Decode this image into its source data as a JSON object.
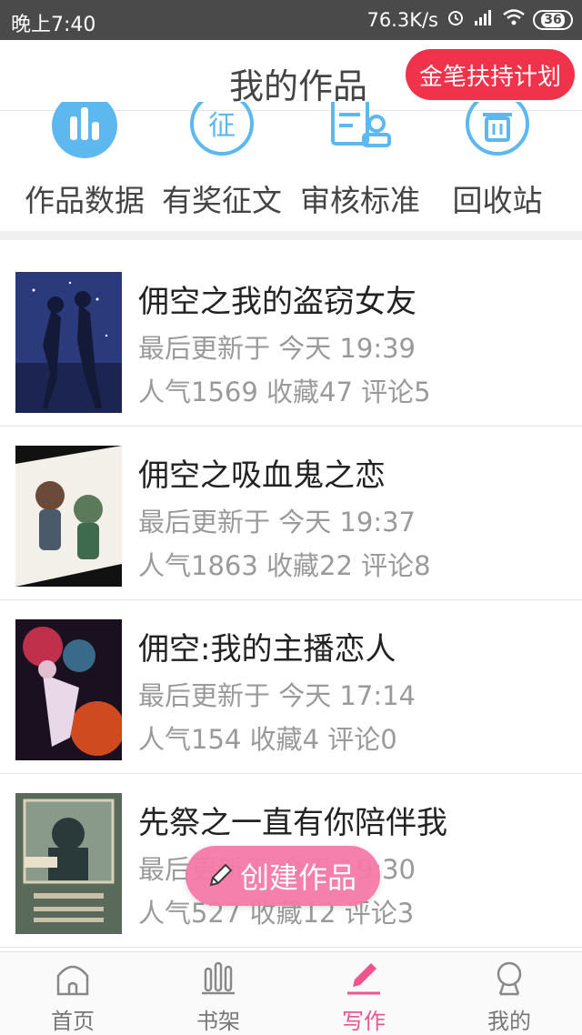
{
  "status_bar": {
    "time": "晚上7:40",
    "speed": "76.3K/s",
    "battery": "36"
  },
  "header": {
    "title": "我的作品",
    "promo_label": "金笔扶持计划"
  },
  "quick_actions": [
    {
      "label": "作品数据",
      "icon": "bar-chart-icon"
    },
    {
      "label": "有奖征文",
      "icon": "contest-icon"
    },
    {
      "label": "审核标准",
      "icon": "review-standard-icon"
    },
    {
      "label": "回收站",
      "icon": "trash-icon"
    }
  ],
  "works": [
    {
      "title": "佣空之我的盗窃女友",
      "updated": "最后更新于 今天 19:39",
      "stats": "人气1569 收藏47 评论5"
    },
    {
      "title": "佣空之吸血鬼之恋",
      "updated": "最后更新于 今天 19:37",
      "stats": "人气1863 收藏22 评论8"
    },
    {
      "title": "佣空:我的主播恋人",
      "updated": "最后更新于 今天 17:14",
      "stats": "人气154 收藏4 评论0"
    },
    {
      "title": "先祭之一直有你陪伴我",
      "updated": "最后更新于 今天 19:30",
      "stats": "人气527 收藏12 评论3"
    }
  ],
  "fab_label": "创建作品",
  "bottom_nav": [
    {
      "label": "首页",
      "icon": "home-icon"
    },
    {
      "label": "书架",
      "icon": "bookshelf-icon"
    },
    {
      "label": "写作",
      "icon": "pen-icon",
      "active": true
    },
    {
      "label": "我的",
      "icon": "profile-icon"
    }
  ],
  "colors": {
    "accent_pink": "#f0548c",
    "promo_red": "#f0324a",
    "icon_blue": "#5cb8ee",
    "status_bar": "#4a4a4a"
  }
}
